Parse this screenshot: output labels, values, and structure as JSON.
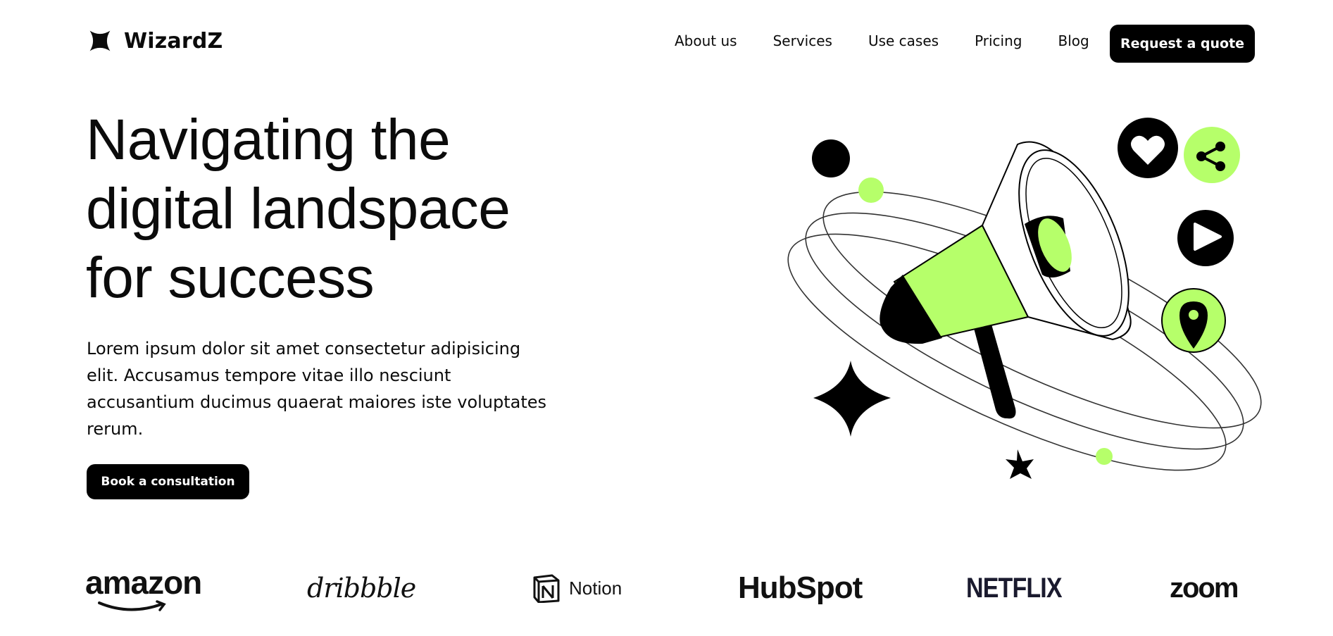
{
  "brand": {
    "name": "WizardZ",
    "logo_icon": "four-point-star-icon"
  },
  "nav": {
    "items": [
      {
        "label": "About us"
      },
      {
        "label": "Services"
      },
      {
        "label": "Use cases"
      },
      {
        "label": "Pricing"
      },
      {
        "label": "Blog"
      }
    ],
    "cta_label": "Request a quote"
  },
  "hero": {
    "title_lines": [
      "Navigating the",
      "digital landspace",
      "for success"
    ],
    "text": "Lorem ipsum dolor sit amet consectetur adipisicing elit. Accusamus tempore vitae illo nesciunt accusantium ducimus quaerat maiores iste voluptates rerum.",
    "cta_label": "Book a consultation"
  },
  "illustration": {
    "icons": [
      "megaphone-icon",
      "heart-icon",
      "share-icon",
      "play-icon",
      "location-pin-icon",
      "sparkle-icon"
    ]
  },
  "brands": [
    {
      "name": "amazon"
    },
    {
      "name": "dribbble"
    },
    {
      "name": "Notion"
    },
    {
      "name": "HubSpot"
    },
    {
      "name": "NETFLIX"
    },
    {
      "name": "zoom"
    }
  ],
  "colors": {
    "accent": "#B6FF6A",
    "primary": "#000000",
    "background": "#FFFFFF"
  }
}
